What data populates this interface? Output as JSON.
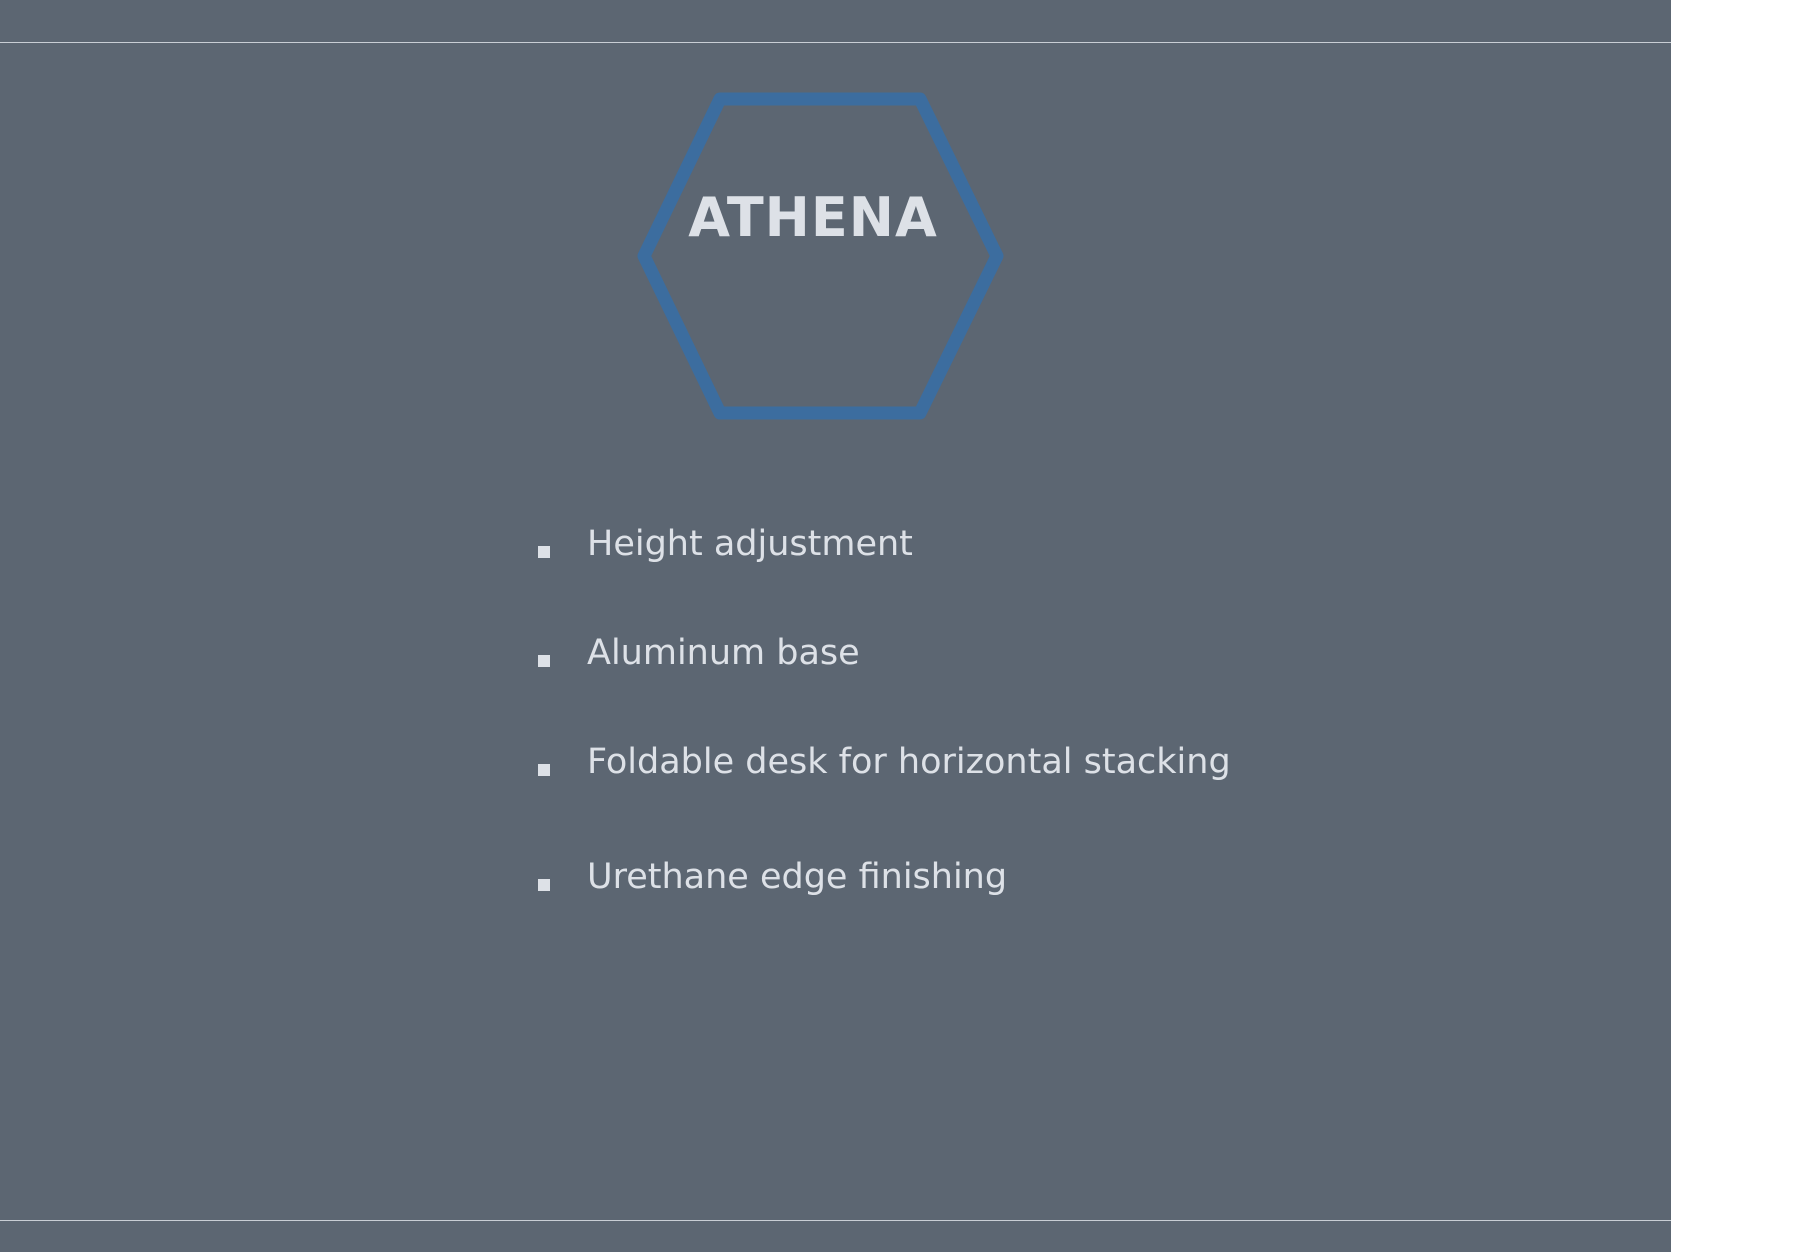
{
  "colors": {
    "slide_background": "#5c6672",
    "hexagon_outline": "#3c6d9f",
    "text": "#dde1e7",
    "rule": "#c9ced5"
  },
  "slide": {
    "title": "ATHENA",
    "bullets": [
      "Height adjustment",
      "Aluminum base",
      "Foldable desk for horizontal stacking",
      "Urethane edge finishing"
    ]
  }
}
